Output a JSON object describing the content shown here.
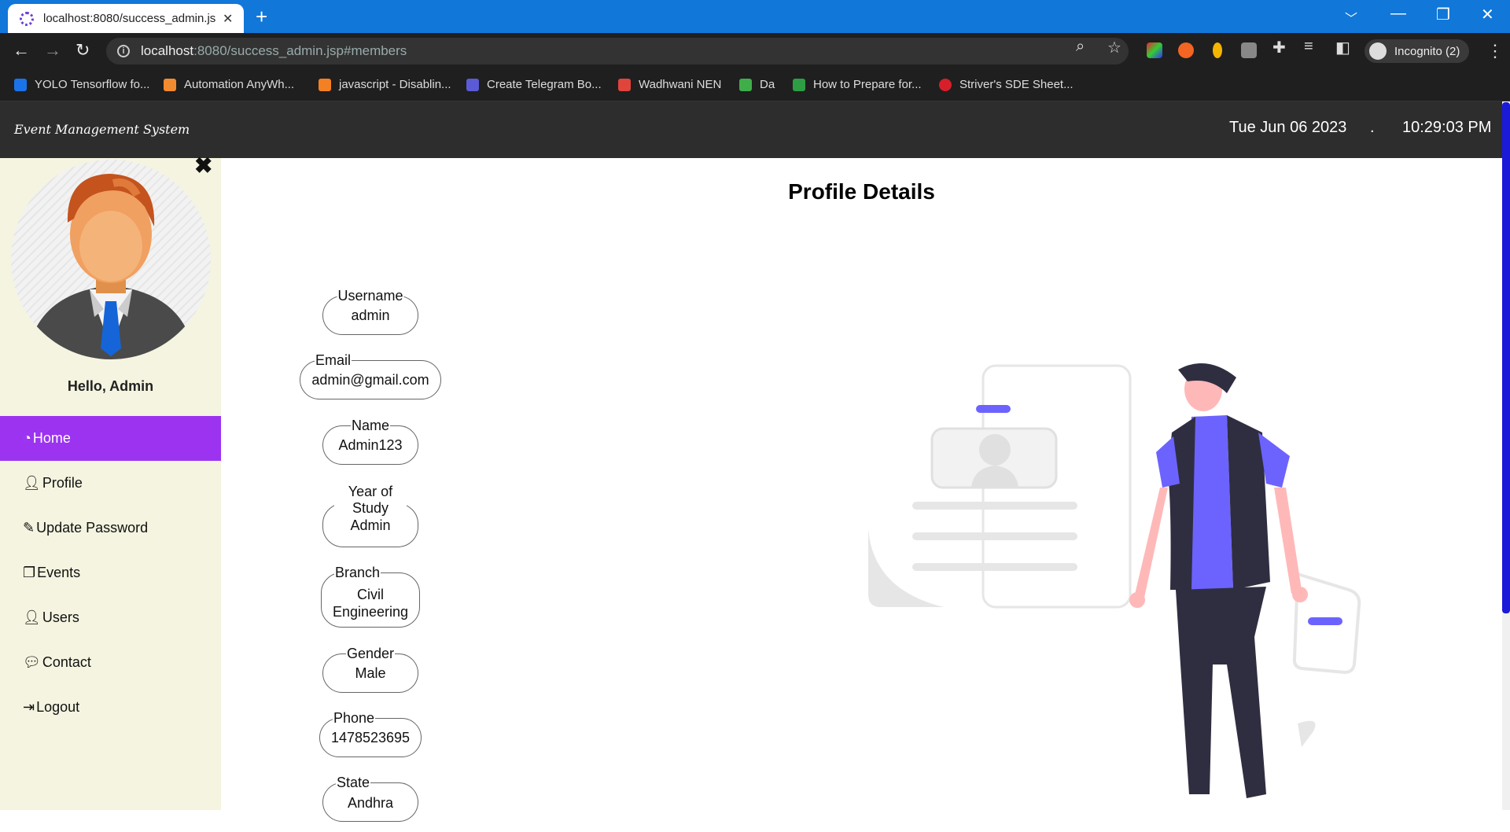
{
  "browser": {
    "tab_title": "localhost:8080/success_admin.jsp",
    "url_host": "localhost",
    "url_rest": ":8080/success_admin.jsp#members",
    "incognito_label": "Incognito (2)",
    "bookmarks": [
      {
        "label": "YOLO Tensorflow fo...",
        "color": "#1a73e8"
      },
      {
        "label": "Automation AnyWh...",
        "color": "#f28b30"
      },
      {
        "label": "javascript - Disablin...",
        "color": "#f48024"
      },
      {
        "label": "Create Telegram Bo...",
        "color": "#5b5bd6"
      },
      {
        "label": "Wadhwani NEN",
        "color": "#e0453c"
      },
      {
        "label": "Da",
        "color": "#3fae49"
      },
      {
        "label": "How to Prepare for...",
        "color": "#2e9e44"
      },
      {
        "label": "Striver's SDE Sheet...",
        "color": "#d71f2a"
      }
    ]
  },
  "header": {
    "brand": "Event Management System",
    "date": "Tue Jun 06 2023",
    "separator": ".",
    "time": "10:29:03 PM"
  },
  "sidebar": {
    "greeting": "Hello, Admin",
    "items": [
      {
        "label": "Home",
        "icon": "dashboard-icon"
      },
      {
        "label": "Profile",
        "icon": "user-icon"
      },
      {
        "label": "Update Password",
        "icon": "edit-icon"
      },
      {
        "label": "Events",
        "icon": "copy-icon"
      },
      {
        "label": "Users",
        "icon": "user-icon"
      },
      {
        "label": "Contact",
        "icon": "chat-icon"
      },
      {
        "label": "Logout",
        "icon": "logout-icon"
      }
    ],
    "active_color": "#9b33f0"
  },
  "main": {
    "title": "Profile Details",
    "fields": [
      {
        "label": "Username",
        "value": "admin"
      },
      {
        "label": "Email",
        "value": "admin@gmail.com"
      },
      {
        "label": "Name",
        "value": "Admin123"
      },
      {
        "label": "Year of Study",
        "value": "Admin"
      },
      {
        "label": "Branch",
        "value": "Civil Engineering"
      },
      {
        "label": "Gender",
        "value": "Male"
      },
      {
        "label": "Phone",
        "value": "1478523695"
      },
      {
        "label": "State",
        "value": "Andhra"
      }
    ]
  },
  "colors": {
    "accent": "#6c63ff",
    "tabbar": "#1177d9",
    "header_bg": "#2d2d2d",
    "sidebar_bg": "#f4f4e0"
  }
}
